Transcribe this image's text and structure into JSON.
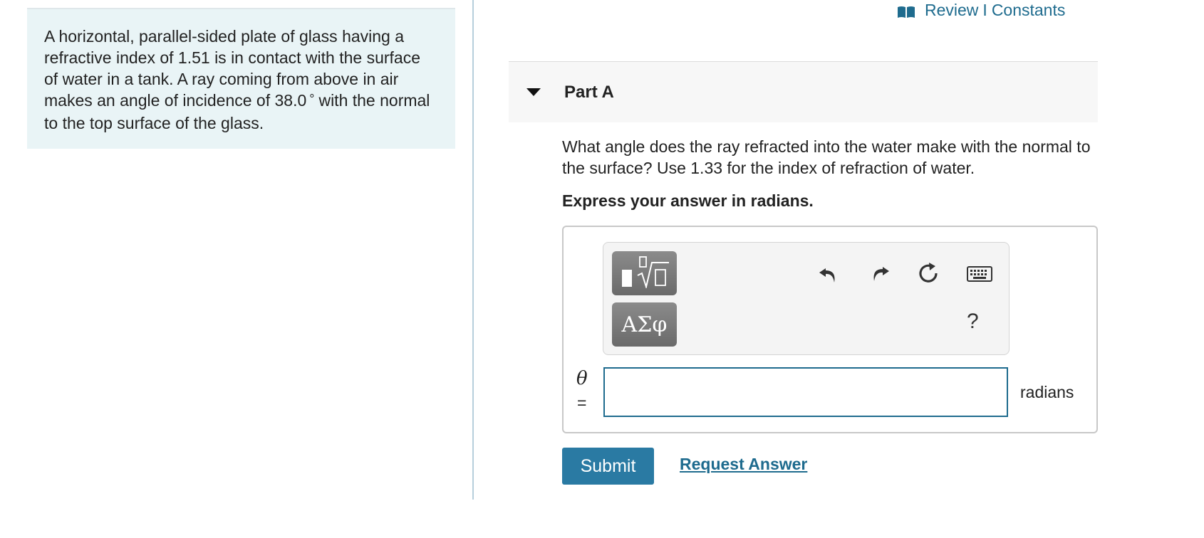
{
  "problem": {
    "text_before_degree": "A horizontal, parallel-sided plate of glass having a refractive index of 1.51 is in contact with the surface of water in a tank. A ray coming from above in air makes an angle of incidence of 38.0",
    "degree_symbol": "°",
    "text_after_degree": "with the normal to the top surface of the glass."
  },
  "header": {
    "icon": "book-icon",
    "review_label": "Review",
    "separator": "I",
    "constants_label": "Constants"
  },
  "part": {
    "caret_icon": "caret-down-icon",
    "title": "Part A",
    "question": "What angle does the ray refracted into the water make with the normal to the surface? Use 1.33 for the index of refraction of water.",
    "instruction": "Express your answer in radians."
  },
  "toolbar": {
    "templates_icon": "templates-sqrt-icon",
    "symbols_label": "ΑΣφ",
    "undo_icon": "undo-icon",
    "redo_icon": "redo-icon",
    "reset_icon": "reset-icon",
    "keyboard_icon": "keyboard-icon",
    "help_label": "?"
  },
  "answer": {
    "variable": "θ",
    "equals": "=",
    "value": "",
    "units": "radians"
  },
  "actions": {
    "submit_label": "Submit",
    "request_answer_label": "Request Answer"
  },
  "colors": {
    "accent": "#1e6b8e",
    "submit_bg": "#2a7aa3",
    "problem_bg": "#e9f4f6",
    "part_header_bg": "#f7f7f7"
  }
}
